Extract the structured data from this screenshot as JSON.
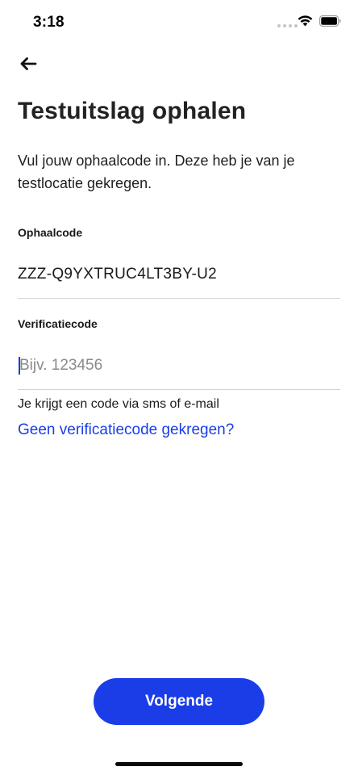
{
  "status_bar": {
    "time": "3:18"
  },
  "header": {
    "back_icon": "arrow-left-icon"
  },
  "page": {
    "title": "Testuitslag ophalen",
    "intro": "Vul jouw ophaalcode in. Deze heb je van je testlocatie gekregen."
  },
  "form": {
    "ophaalcode": {
      "label": "Ophaalcode",
      "value": "ZZZ-Q9YXTRUC4LT3BY-U2"
    },
    "verificatiecode": {
      "label": "Verificatiecode",
      "value": "",
      "placeholder": "Bijv. 123456"
    },
    "hint": "Je krijgt een code via sms of e-mail",
    "help_link": "Geen verificatiecode gekregen?"
  },
  "footer": {
    "primary_button": "Volgende"
  },
  "colors": {
    "accent": "#1a3de8",
    "divider": "#d4d4d4",
    "text": "#1a1a1a"
  }
}
